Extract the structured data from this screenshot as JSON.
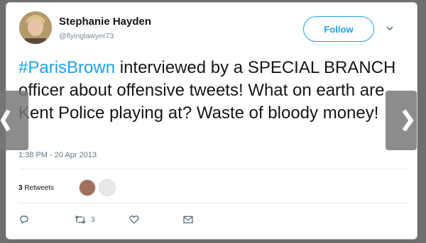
{
  "tweet": {
    "author_name": "Stephanie Hayden",
    "author_handle": "@flyinglawyer73",
    "follow_label": "Follow",
    "hashtag": "#ParisBrown",
    "text_rest": " interviewed by a SPECIAL BRANCH officer about offensive tweets! What on earth are Kent Police playing at? Waste of bloody money!",
    "timestamp": "1:38 PM - 20 Apr 2013",
    "retweets_count": "3",
    "retweets_label": "Retweets",
    "retweet_action_count": "3"
  },
  "icons": {
    "reply": "reply-icon",
    "retweet": "retweet-icon",
    "like": "heart-icon",
    "message": "envelope-icon",
    "more": "chevron-down-icon",
    "prev": "chevron-left-icon",
    "next": "chevron-right-icon"
  },
  "colors": {
    "accent": "#1da1f2",
    "text": "#14171a",
    "muted": "#657786"
  }
}
